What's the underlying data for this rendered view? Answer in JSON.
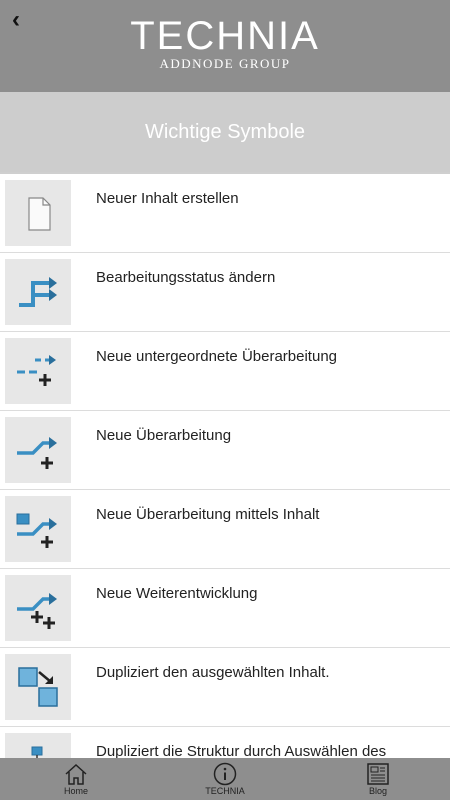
{
  "header": {
    "back_icon": "chevron-left-icon",
    "logo_title": "TECHNIA",
    "logo_subtitle": "ADDNODE GROUP"
  },
  "page_title": "Wichtige Symbole",
  "items": [
    {
      "icon": "new-document-icon",
      "label": "Neuer Inhalt erstellen"
    },
    {
      "icon": "change-status-icon",
      "label": "Bearbeitungsstatus ändern"
    },
    {
      "icon": "new-sub-revision-icon",
      "label": "Neue untergeordnete Überarbeitung"
    },
    {
      "icon": "new-revision-icon",
      "label": "Neue Überarbeitung"
    },
    {
      "icon": "new-revision-from-content-icon",
      "label": "Neue Überarbeitung mittels Inhalt"
    },
    {
      "icon": "new-evolution-icon",
      "label": "Neue Weiterentwicklung"
    },
    {
      "icon": "duplicate-selected-icon",
      "label": "Dupliziert den ausgewählten Inhalt."
    },
    {
      "icon": "duplicate-structure-icon",
      "label": "Dupliziert die Struktur durch Auswählen des wiederzuverwendenden Inhalts."
    }
  ],
  "tabs": [
    {
      "icon": "home-icon",
      "label": "Home"
    },
    {
      "icon": "info-icon",
      "label": "TECHNIA"
    },
    {
      "icon": "newspaper-icon",
      "label": "Blog"
    }
  ],
  "colors": {
    "header_bg": "#8e8e8e",
    "title_bg": "#cdcdcd",
    "icon_blue": "#3a8fc3"
  }
}
